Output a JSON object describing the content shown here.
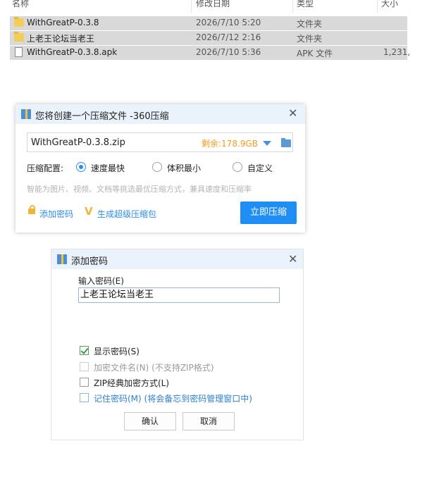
{
  "file_list": {
    "columns": [
      "名称",
      "修改日期",
      "类型",
      "大小"
    ],
    "rows": [
      {
        "icon": "folder-icon",
        "name": "WithGreatP-0.3.8",
        "date": "2026/7/10 5:20",
        "type": "文件夹",
        "size": ""
      },
      {
        "icon": "folder-icon",
        "name": "上老王论坛当老王",
        "date": "2026/7/12 2:16",
        "type": "文件夹",
        "size": ""
      },
      {
        "icon": "file-icon",
        "name": "WithGreatP-0.3.8.apk",
        "date": "2026/7/10 5:36",
        "type": "APK 文件",
        "size": "1,231,"
      }
    ]
  },
  "compress_dialog": {
    "title": "您将创建一个压缩文件 -360压缩",
    "filename": "WithGreatP-0.3.8.zip",
    "free_space": "剩余:178.9GB",
    "config_label": "压缩配置:",
    "options": [
      {
        "label": "速度最快",
        "selected": true
      },
      {
        "label": "体积最小",
        "selected": false
      },
      {
        "label": "自定义",
        "selected": false
      }
    ],
    "hint": "智能为图片、视频、文档等挑选最优压缩方式，兼具速度和压缩率",
    "add_password_link": "添加密码",
    "super_pack_link": "生成超级压缩包",
    "compress_button": "立即压缩",
    "colors": {
      "accent": "#1e8ef5",
      "warning": "#f39b1a",
      "titlebar": "#eaf3fb"
    }
  },
  "password_dialog": {
    "title": "添加密码",
    "input_label": "输入密码(E)",
    "password_value": "上老王论坛当老王",
    "checkboxes": [
      {
        "label": "显示密码(S)",
        "checked": true,
        "enabled": true
      },
      {
        "label": "加密文件名(N) (不支持ZIP格式)",
        "checked": false,
        "enabled": false
      },
      {
        "label": "ZIP经典加密方式(L)",
        "checked": false,
        "enabled": true
      },
      {
        "label": "记住密码(M) (将会备忘到密码管理窗口中)",
        "checked": false,
        "enabled": true
      }
    ],
    "ok_button": "确认",
    "cancel_button": "取消"
  }
}
